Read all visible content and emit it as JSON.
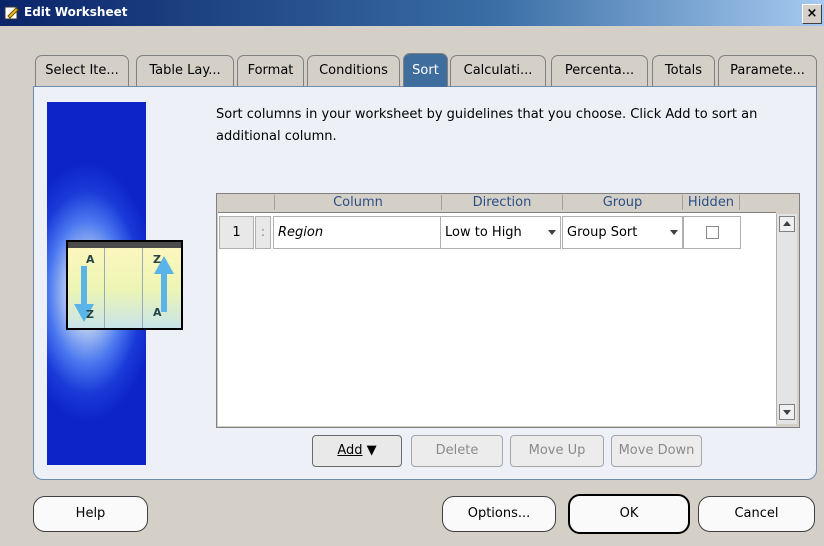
{
  "window": {
    "title": "Edit Worksheet",
    "close_label": "×"
  },
  "tabs": [
    {
      "label": "Select Ite...",
      "active": false
    },
    {
      "label": "Table Lay...",
      "active": false
    },
    {
      "label": "Format",
      "active": false
    },
    {
      "label": "Conditions",
      "active": false
    },
    {
      "label": "Sort",
      "active": true
    },
    {
      "label": "Calculati...",
      "active": false
    },
    {
      "label": "Percenta...",
      "active": false
    },
    {
      "label": "Totals",
      "active": false
    },
    {
      "label": "Paramete...",
      "active": false
    }
  ],
  "sort": {
    "description": "Sort columns in your worksheet by guidelines that you choose.  Click Add to sort an additional column.",
    "graphic_letters": {
      "top_left": "A",
      "top_right": "Z",
      "bottom_left": "Z",
      "bottom_right": "A"
    },
    "headers": {
      "column": "Column",
      "direction": "Direction",
      "group": "Group",
      "hidden": "Hidden"
    },
    "rows": [
      {
        "number": "1",
        "column": "Region",
        "direction": "Low to High",
        "group": "Group Sort",
        "hidden": false
      }
    ],
    "buttons": {
      "add": "Add",
      "delete": "Delete",
      "move_up": "Move Up",
      "move_down": "Move Down"
    }
  },
  "footer": {
    "help": "Help",
    "options": "Options...",
    "ok": "OK",
    "cancel": "Cancel"
  },
  "colors": {
    "title_bar": "#0a246a",
    "active_tab": "#3f6d9e",
    "header_text": "#2c4e88"
  }
}
